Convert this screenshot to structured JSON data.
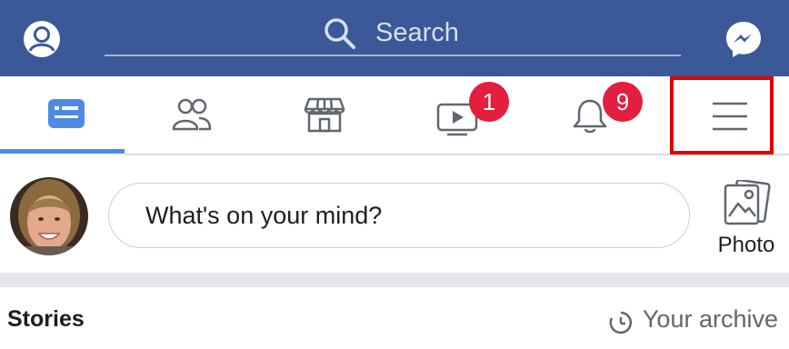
{
  "topbar": {
    "search_placeholder": "Search",
    "background": "#3b5998",
    "icons": {
      "profile": "profile-icon",
      "search": "search-icon",
      "messenger": "messenger-icon"
    }
  },
  "tabs": [
    {
      "name": "news-feed",
      "icon": "news-feed-icon",
      "active": true
    },
    {
      "name": "friends",
      "icon": "friends-icon"
    },
    {
      "name": "marketplace",
      "icon": "marketplace-icon"
    },
    {
      "name": "watch",
      "icon": "watch-icon",
      "badge": "1"
    },
    {
      "name": "notifications",
      "icon": "bell-icon",
      "badge": "9"
    },
    {
      "name": "menu",
      "icon": "hamburger-menu-icon",
      "highlighted": true
    }
  ],
  "composer": {
    "placeholder": "What's on your mind?",
    "photo_label": "Photo"
  },
  "stories": {
    "title": "Stories",
    "archive_label": "Your archive"
  },
  "colors": {
    "accent": "#4d8ae6",
    "badge": "#e41e3f",
    "highlight": "#e00000"
  }
}
